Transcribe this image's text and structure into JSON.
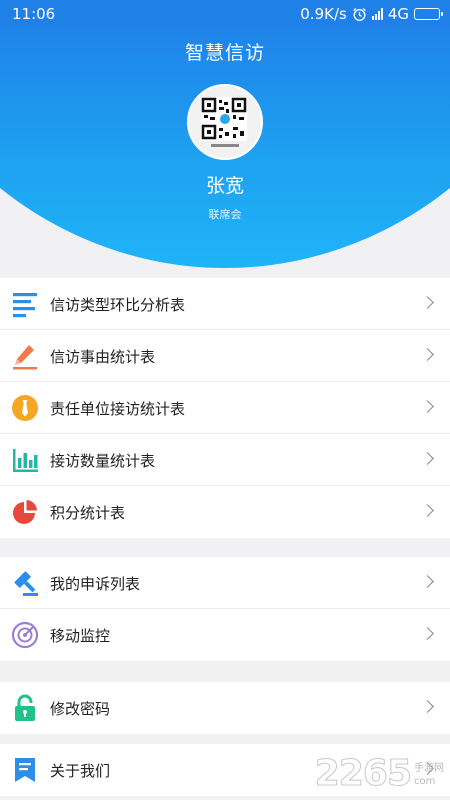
{
  "status_bar": {
    "time": "11:06",
    "network_speed": "0.9K/s",
    "network_type": "4G",
    "battery_level": 0.2
  },
  "header": {
    "title": "智慧信访",
    "user_name": "张宽",
    "org": "联席会"
  },
  "menu_groups": [
    {
      "items": [
        {
          "label": "信访类型环比分析表",
          "icon": "list-lines-icon"
        },
        {
          "label": "信访事由统计表",
          "icon": "pencil-icon"
        },
        {
          "label": "责任单位接访统计表",
          "icon": "necktie-icon"
        },
        {
          "label": "接访数量统计表",
          "icon": "bar-chart-icon"
        },
        {
          "label": "积分统计表",
          "icon": "pie-chart-icon"
        }
      ]
    },
    {
      "items": [
        {
          "label": "我的申诉列表",
          "icon": "gavel-icon"
        },
        {
          "label": "移动监控",
          "icon": "radar-icon"
        }
      ]
    },
    {
      "items": [
        {
          "label": "修改密码",
          "icon": "lock-icon"
        }
      ]
    },
    {
      "items": [
        {
          "label": "关于我们",
          "icon": "bookmark-icon"
        }
      ]
    }
  ],
  "watermark": {
    "number": "2265",
    "site": "手游网",
    "suffix": "com"
  },
  "colors": {
    "header_blue": "#1f80e8",
    "header_light": "#1fb4f7",
    "divider": "#ececec",
    "background": "#f1f1f3"
  }
}
